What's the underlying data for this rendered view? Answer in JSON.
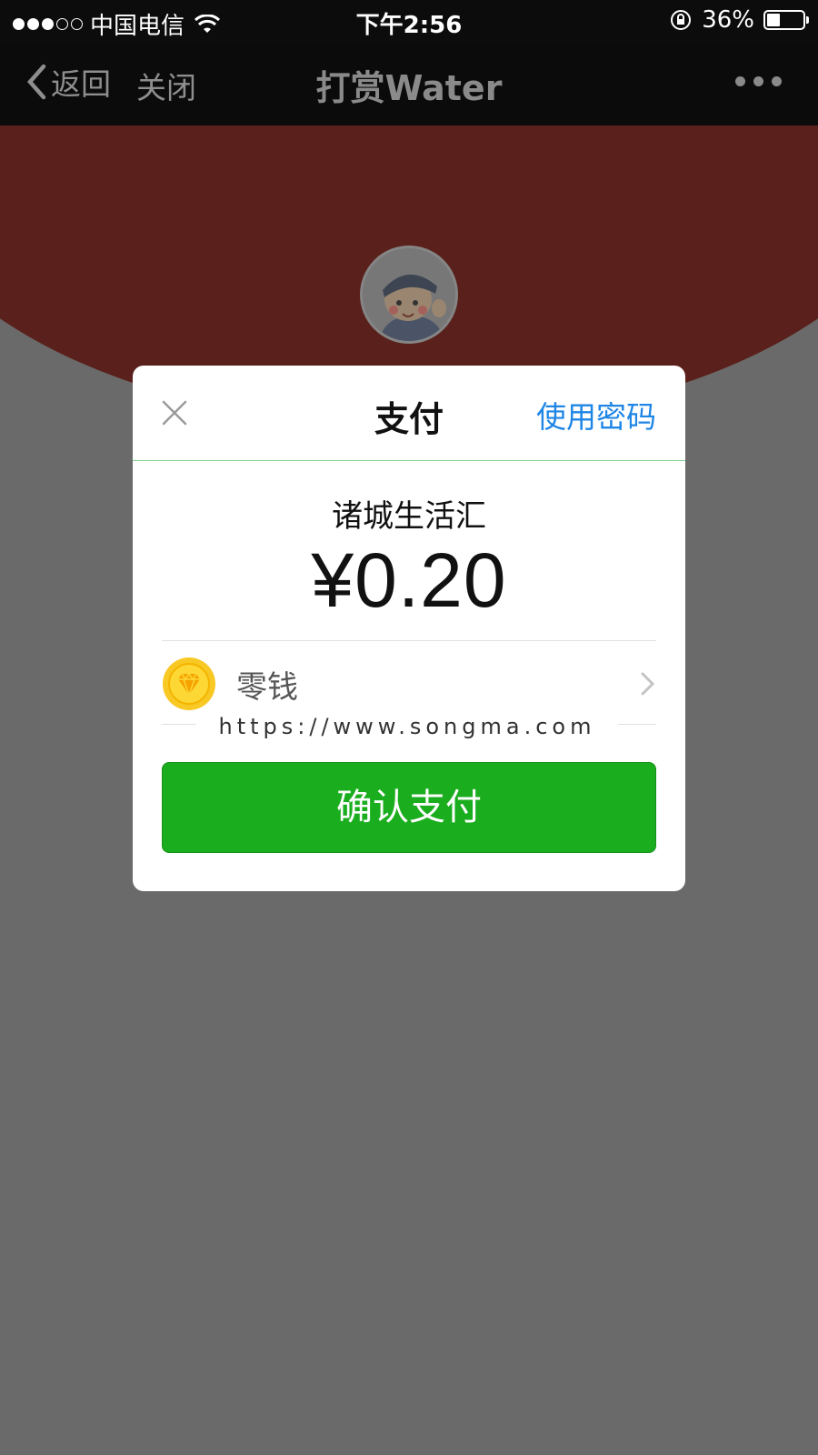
{
  "status_bar": {
    "carrier": "中国电信",
    "time": "下午2:56",
    "battery": "36%",
    "battery_level": 0.36,
    "signal_bars_filled": 3,
    "signal_bars_total": 5
  },
  "nav": {
    "back_label": "返回",
    "close_label": "关闭",
    "title": "打赏Water"
  },
  "dialog": {
    "title": "支付",
    "use_password": "使用密码",
    "merchant": "诸城生活汇",
    "amount": "¥0.20",
    "payment_method": "零钱",
    "confirm_label": "确认支付"
  },
  "watermark": "https://www.songma.com",
  "colors": {
    "accent_blue": "#1f86e6",
    "confirm_green": "#1aad1e",
    "coin_yellow": "#f8c824",
    "header_red": "#5a211c"
  }
}
